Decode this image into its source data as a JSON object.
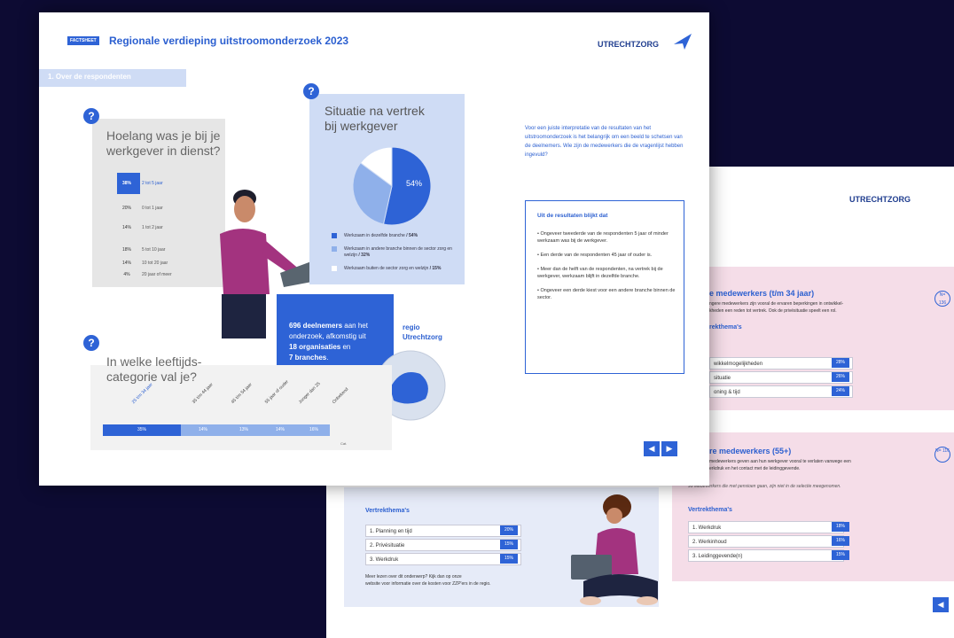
{
  "back": {
    "logo": "UTRECHTZORG",
    "young": {
      "title": "e medewerkers (t/m 34 jaar)",
      "desc1": "ngere medewerkers zijn vooral de ervaren beperkingen in ontwikkel-",
      "desc2": "kheden een reden tot vertrek. Ook de privésituatie speelt een rol.",
      "themes_label": "rekthema's",
      "rows": [
        {
          "label": "wikkelmogelijkheden",
          "pct": "28%"
        },
        {
          "label": "situatie",
          "pct": "26%"
        },
        {
          "label": "oning & tijd",
          "pct": "24%"
        }
      ],
      "badge": "N= 136"
    },
    "older": {
      "title": "re medewerkers (55+)",
      "desc1": "medewerkers geven aan hun werkgever vooral te verlaten vanwege een",
      "desc2": "erkdruk en het contact met de leidinggevende.",
      "note": "99 Medewerkers die met pensioen gaan, zijn niet in de selectie meegenomen.",
      "themes_label": "Vertrekthema's",
      "rows": [
        {
          "label": "1. Werkdruk",
          "pct": "18%"
        },
        {
          "label": "2. Werkinhoud",
          "pct": "16%"
        },
        {
          "label": "3. Leidinggevende(n)",
          "pct": "15%"
        }
      ],
      "badge": "N= 116"
    },
    "mid": {
      "themes_label": "Vertrekthema's",
      "rows": [
        {
          "label": "1. Planning en tijd",
          "pct": "20%"
        },
        {
          "label": "2. Privésituatie",
          "pct": "15%"
        },
        {
          "label": "3. Werkdruk",
          "pct": "15%"
        }
      ],
      "note1": "Meer lezen over dit onderwerp? Kijk dan op onze",
      "note2": "website voor informatie over de kosten voor ZZP'ers in de regio."
    }
  },
  "front": {
    "factsheet_tag": "FACTSHEET",
    "title": "Regionale verdieping uitstroomonderzoek 2023",
    "logo": "UTRECHTZORG",
    "section_tab": "1. Over de respondenten",
    "q1": {
      "badge": "?",
      "line1": "Hoelang was je bij je",
      "line2": "werkgever in dienst?",
      "rows": [
        {
          "pct": "38%",
          "label": "2 tot 5 jaar"
        },
        {
          "pct": "20%",
          "label": "0 tot 1 jaar"
        },
        {
          "pct": "14%",
          "label": "1 tot 2 jaar"
        },
        {
          "pct": "18%",
          "label": "5 tot 10 jaar"
        },
        {
          "pct": "14%",
          "label": "10 tot 20 jaar"
        },
        {
          "pct": "4%",
          "label": "20 jaar of meer"
        }
      ]
    },
    "q2": {
      "badge": "?",
      "line1": "Situatie na vertrek",
      "line2": "bij werkgever",
      "pie_label": "54%",
      "legend": [
        {
          "text": "Werkzaam in dezelfde branche",
          "pct": "/ 54%",
          "color": "#2e63d6"
        },
        {
          "text": "Werkzaam in andere branche binnen de sector zorg en welzijn",
          "pct": "/ 32%",
          "color": "#8fb0ea"
        },
        {
          "text": "Werkzaam buiten de sector zorg en welzijn",
          "pct": "/ 15%",
          "color": "#ffffff"
        }
      ],
      "slices": [
        54,
        32,
        15
      ]
    },
    "q3": {
      "badge": "?",
      "line1": "In welke leeftijds-",
      "line2": "categorie val je?",
      "ages": [
        "25 t/m 34 jaar",
        "35 t/m 44 jaar",
        "45 t/m 54 jaar",
        "55 jaar of ouder",
        "Jonger dan 25",
        "Onbekend"
      ],
      "bars": [
        "35%",
        "14%",
        "13%",
        "14%",
        "16%"
      ],
      "legend": "Cat."
    },
    "participants": {
      "count": "696 deelnemers",
      "text1": " aan het",
      "text2": "onderzoek, afkomstig uit",
      "orgs": "18 organisaties",
      "text3": " en",
      "branches": "7 branches",
      "end": "."
    },
    "region": {
      "line1": "regio",
      "line2": "Utrechtzorg"
    },
    "intro": "Voor een juiste interpretatie van de resultaten van het uitstroomonderzoek is het belangrijk om een beeld te schetsen van de deelnemers. Wie zijn de medewerkers die de vragenlijst hebben ingevuld?",
    "results": {
      "title": "Uit de resultaten blijkt dat",
      "bullets": [
        "• Ongeveer tweederde van de respondenten 5 jaar of minder werkzaam was bij de werkgever.",
        "• Een derde van de respondenten 45 jaar of ouder is.",
        "• Meer dan de helft van de respondenten, na vertrek bij de werkgever, werkzaam blijft in dezelfde branche.",
        "• Ongeveer een derde kiest voor een andere branche binnen de sector."
      ]
    },
    "nav": {
      "prev": "◀",
      "next": "▶"
    }
  },
  "back_nav": {
    "prev": "◀"
  }
}
